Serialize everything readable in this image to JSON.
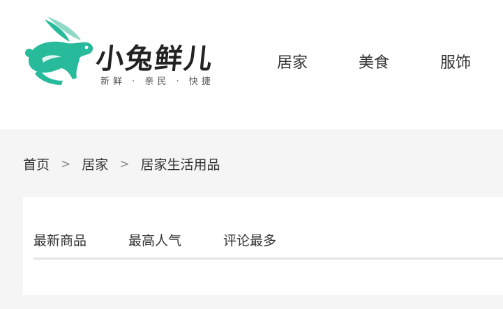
{
  "brand": {
    "name": "小兔鲜儿",
    "slogan": "新鲜 · 亲民 · 快捷",
    "logo_icon": "rabbit-logo-icon",
    "accent_color": "#27BA9B"
  },
  "nav": {
    "items": [
      {
        "label": "居家"
      },
      {
        "label": "美食"
      },
      {
        "label": "服饰"
      }
    ]
  },
  "breadcrumb": {
    "items": [
      {
        "label": "首页"
      },
      {
        "label": "居家"
      }
    ],
    "separator": ">",
    "current": "居家生活用品"
  },
  "sort_tabs": {
    "items": [
      {
        "label": "最新商品"
      },
      {
        "label": "最高人气"
      },
      {
        "label": "评论最多"
      }
    ]
  }
}
